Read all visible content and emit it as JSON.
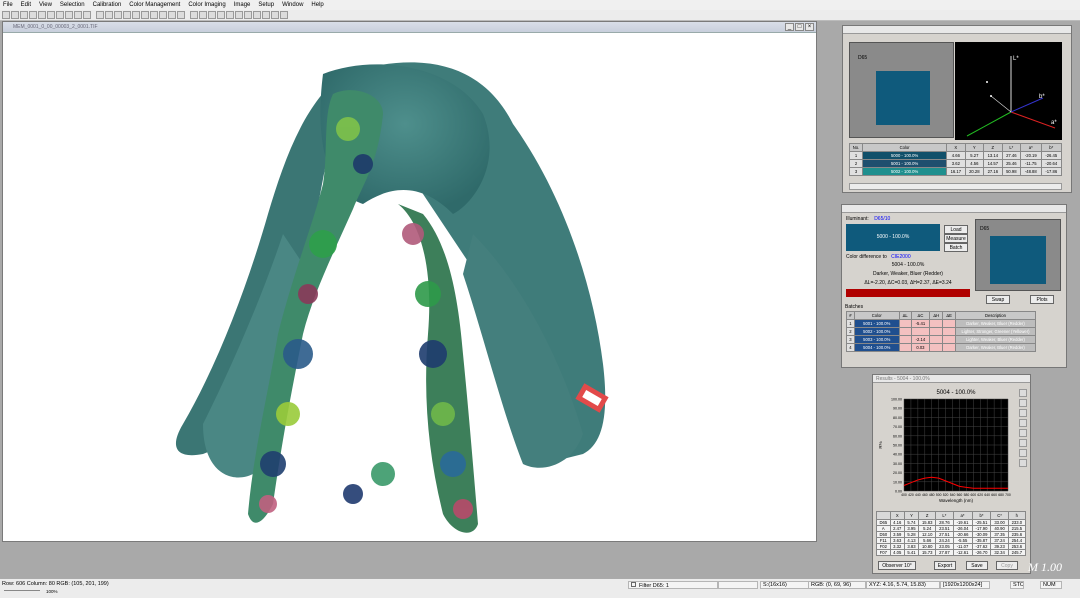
{
  "menu": [
    "File",
    "Edit",
    "View",
    "Selection",
    "Calibration",
    "Color Management",
    "Color Imaging",
    "Image",
    "Setup",
    "Window",
    "Help"
  ],
  "image_window": {
    "title": "MEM_0001_0_00_00003_2_0001.TIF",
    "content": "teal silk scarf with green, blue and pink floral print, with hang tag"
  },
  "panel3d": {
    "illuminant": "D65",
    "axis_labels": {
      "L": "L*",
      "a": "a*",
      "b": "b*"
    },
    "headers": [
      "No.",
      "Color",
      "X",
      "Y",
      "Z",
      "L*",
      "a*",
      "b*"
    ],
    "rows": [
      {
        "no": "1",
        "color": "5000 - 100.0%",
        "x": "4.66",
        "y": "5.27",
        "z": "13.14",
        "l": "27.46",
        "a": "-20.19",
        "b": "-26.45"
      },
      {
        "no": "2",
        "color": "5001 - 100.0%",
        "x": "3.62",
        "y": "4.56",
        "z": "14.57",
        "l": "25.46",
        "a": "-11.75",
        "b": "-20.64"
      },
      {
        "no": "3",
        "color": "5002 - 100.0%",
        "x": "16.17",
        "y": "20.28",
        "z": "27.16",
        "l": "50.98",
        "a": "-48.88",
        "b": "-17.86"
      }
    ],
    "swatch_colors": [
      "#11506a",
      "#1e4f6e",
      "#1f8f8e"
    ]
  },
  "diff_panel": {
    "illuminant_label": "Illuminant:",
    "illuminant_value": "D65/10",
    "std_label": "5000 - 100.0%",
    "diff_label": "Color difference to",
    "diff_target": "CIE2000",
    "batch_name": "5004 - 100.0%",
    "description": "Darker, Weaker, Bluer (Redder)",
    "deltas": "ΔL=-2.20, ΔC=0.03, ΔH=2.37, ΔE=3.24",
    "buttons": {
      "load": "Load",
      "measure": "Measure",
      "batch": "Batch",
      "swap": "Swap",
      "plots": "Plots"
    },
    "preview_label": "D65",
    "batches_label": "Batches",
    "batch_headers": [
      "#",
      "Color",
      "ΔL",
      "ΔC",
      "ΔH",
      "ΔE",
      "Description"
    ],
    "batches": [
      {
        "n": "1",
        "color": "5001 - 100.0%",
        "dl": "",
        "dc": "-5.41",
        "dh": "",
        "de": "",
        "desc": "Darker, Weaker, Bluer (Redder)"
      },
      {
        "n": "2",
        "color": "5002 - 100.0%",
        "dl": "",
        "dc": "",
        "dh": "",
        "de": "",
        "desc": "Lighter, Stronger, Greener (Yellower)"
      },
      {
        "n": "3",
        "color": "5003 - 100.0%",
        "dl": "",
        "dc": "-2.14",
        "dh": "",
        "de": "",
        "desc": "Lighter, Weaker, Bluer (Redder)"
      },
      {
        "n": "4",
        "color": "5004 - 100.0%",
        "dl": "",
        "dc": "0.03",
        "dh": "",
        "de": "",
        "desc": "Darker, Weaker, Bluer (Redder)"
      }
    ]
  },
  "results_panel": {
    "title": "Results - 5004 - 100.0%",
    "chart_title": "5004 - 100.0%",
    "x_label": "Wavelength (nm)",
    "y_label": "R%",
    "table_headers": [
      "",
      "X",
      "Y",
      "Z",
      "L*",
      "a*",
      "b*",
      "C*",
      "h"
    ],
    "table_rows": [
      [
        "D65",
        "4.16",
        "5.74",
        "15.83",
        "28.76",
        "-19.61",
        "-25.51",
        "33.00",
        "233.0"
      ],
      [
        "A",
        "2.47",
        "3.95",
        "5.24",
        "23.51",
        "-26.04",
        "-17.90",
        "40.90",
        "215.5"
      ],
      [
        "D50",
        "3.59",
        "5.28",
        "12.10",
        "27.51",
        "-20.66",
        "-30.09",
        "37.35",
        "235.6"
      ],
      [
        "F11",
        "3.63",
        "4.13",
        "5.66",
        "24.24",
        "-5.55",
        "-35.87",
        "37.24",
        "254.4"
      ],
      [
        "F02",
        "3.32",
        "3.83",
        "10.80",
        "23.05",
        "-11.07",
        "-37.62",
        "39.23",
        "253.6"
      ],
      [
        "F07",
        "4.05",
        "5.41",
        "15.73",
        "27.87",
        "-12.61",
        "-26.70",
        "32.34",
        "245.7"
      ]
    ],
    "buttons": {
      "observer": "Observer 10°",
      "export": "Export",
      "save": "Save",
      "copy": "Copy"
    }
  },
  "chart_data": {
    "type": "line",
    "title": "5004 - 100.0%",
    "xlabel": "Wavelength (nm)",
    "ylabel": "R%",
    "xlim": [
      400,
      700
    ],
    "ylim": [
      0,
      100
    ],
    "x_ticks": [
      "400",
      "420",
      "440",
      "460",
      "480",
      "500",
      "520",
      "540",
      "560",
      "580",
      "600",
      "620",
      "640",
      "660",
      "680",
      "700"
    ],
    "y_ticks": [
      "100.00",
      "90.00",
      "80.00",
      "70.00",
      "60.00",
      "50.00",
      "40.00",
      "30.00",
      "20.00",
      "10.00",
      "0.00"
    ],
    "series": [
      {
        "color": "#ff0000",
        "x": [
          400,
          420,
          440,
          460,
          480,
          500,
          520,
          540,
          560,
          580,
          600,
          620,
          640,
          660,
          680,
          700
        ],
        "values": [
          6,
          9,
          12,
          14,
          15,
          14,
          11,
          8,
          5,
          4,
          3,
          3,
          3,
          3,
          3,
          3
        ]
      }
    ],
    "grid": true
  },
  "status": {
    "pos": "Row: 606 Column: 80  RGB: (105, 201, 199)",
    "filter": "Filter D65: 1",
    "size": "S:(16x16)",
    "rgb2": "RGB: (0, 69, 96)",
    "xyz": "XYZ: 4.16, 5.74, 15.83)",
    "dims": "[1920x1200x24]",
    "num": "NUM",
    "sto": "STO",
    "zoom": "100%"
  },
  "watermark": "M 1.00"
}
